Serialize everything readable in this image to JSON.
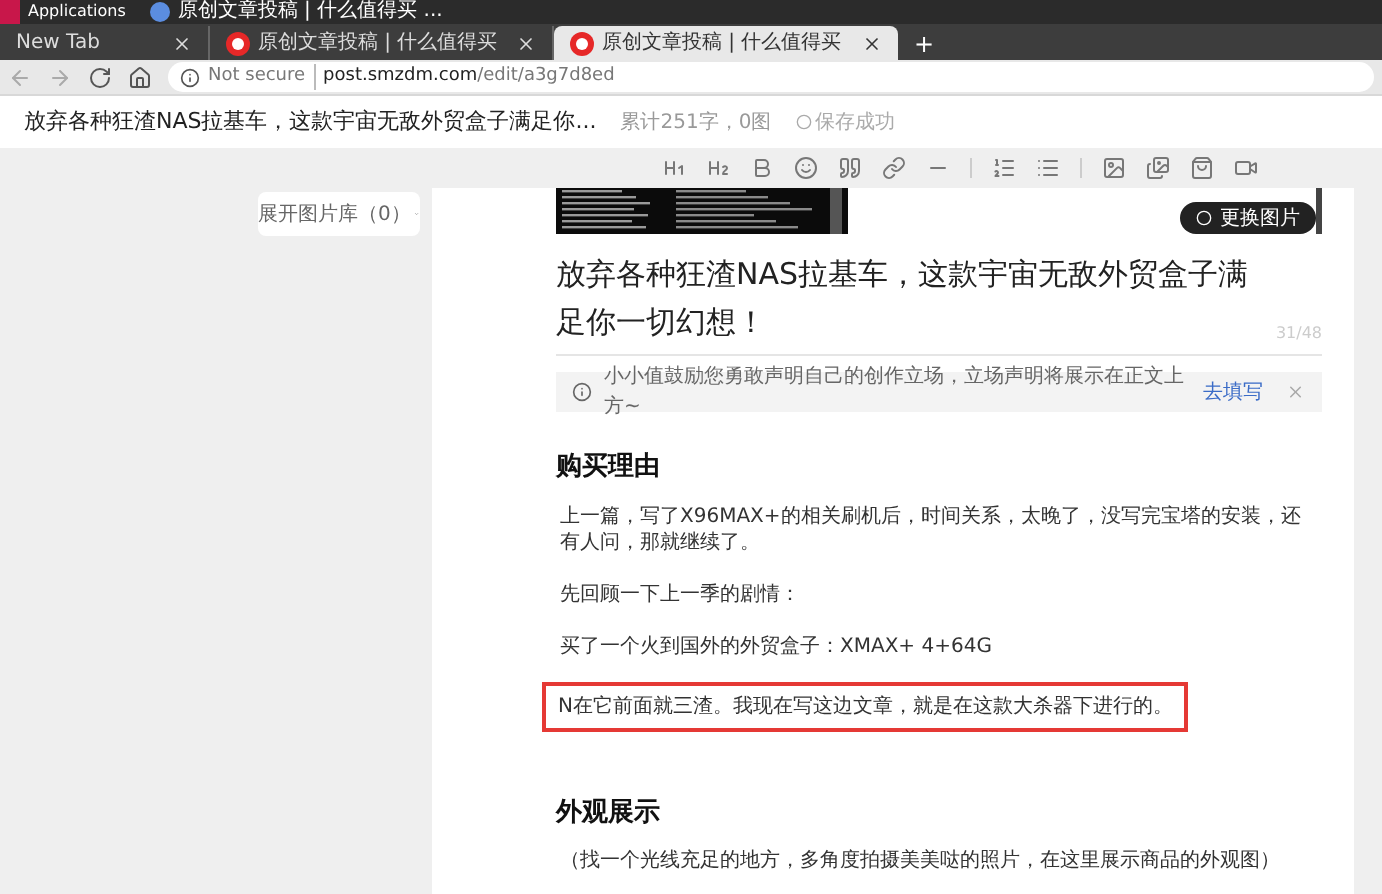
{
  "taskbar": {
    "menu": "Applications",
    "window": "原创文章投稿 | 什么值得买 ..."
  },
  "tabs": [
    {
      "title": "New Tab",
      "selected": false,
      "kind": "plain"
    },
    {
      "title": "原创文章投稿 | 什么值得买",
      "selected": false,
      "kind": "site"
    },
    {
      "title": "原创文章投稿 | 什么值得买",
      "selected": true,
      "kind": "site"
    }
  ],
  "new_tab": "+",
  "address": {
    "security": "Not secure",
    "host": "post.smzdm.com",
    "path": "/edit/a3g7d8ed"
  },
  "header": {
    "title": "放弃各种狂渣NAS拉基车，这款宇宙无敌外贸盒子满足你...",
    "stats": "累计251字，0图",
    "save_status": "保存成功"
  },
  "gallery_button": "展开图片库（0）",
  "cover": {
    "kind": "picture",
    "replace_button": "更换图片"
  },
  "article": {
    "title": "放弃各种狂渣NAS拉基车，这款宇宙无敌外贸盒子满足你一切幻想！",
    "counter": "31/48",
    "notice": {
      "text": "小小值鼓励您勇敢声明自己的创作立场，立场声明将展示在正文上方~",
      "link": "去填写"
    },
    "blocks": [
      {
        "kind": "heading",
        "text": "购买理由",
        "highlighted": false
      },
      {
        "kind": "paragraph",
        "text": "上一篇，写了X96MAX+的相关刷机后，时间关系，太晚了，没写完宝塔的安装，还有人问，那就继续了。",
        "highlighted": false
      },
      {
        "kind": "paragraph",
        "text": "先回顾一下上一季的剧情：",
        "highlighted": false
      },
      {
        "kind": "paragraph",
        "text": "买了一个火到国外的外贸盒子：XMAX+  4+64G",
        "highlighted": false
      },
      {
        "kind": "paragraph",
        "text": "N在它前面就三渣。我现在写这边文章，就是在这款大杀器下进行的。",
        "highlighted": true
      },
      {
        "kind": "heading",
        "text": "外观展示",
        "highlighted": false
      },
      {
        "kind": "paragraph",
        "text": "（找一个光线充足的地方，多角度拍摄美美哒的照片，在这里展示商品的外观图）",
        "highlighted": false
      }
    ]
  }
}
